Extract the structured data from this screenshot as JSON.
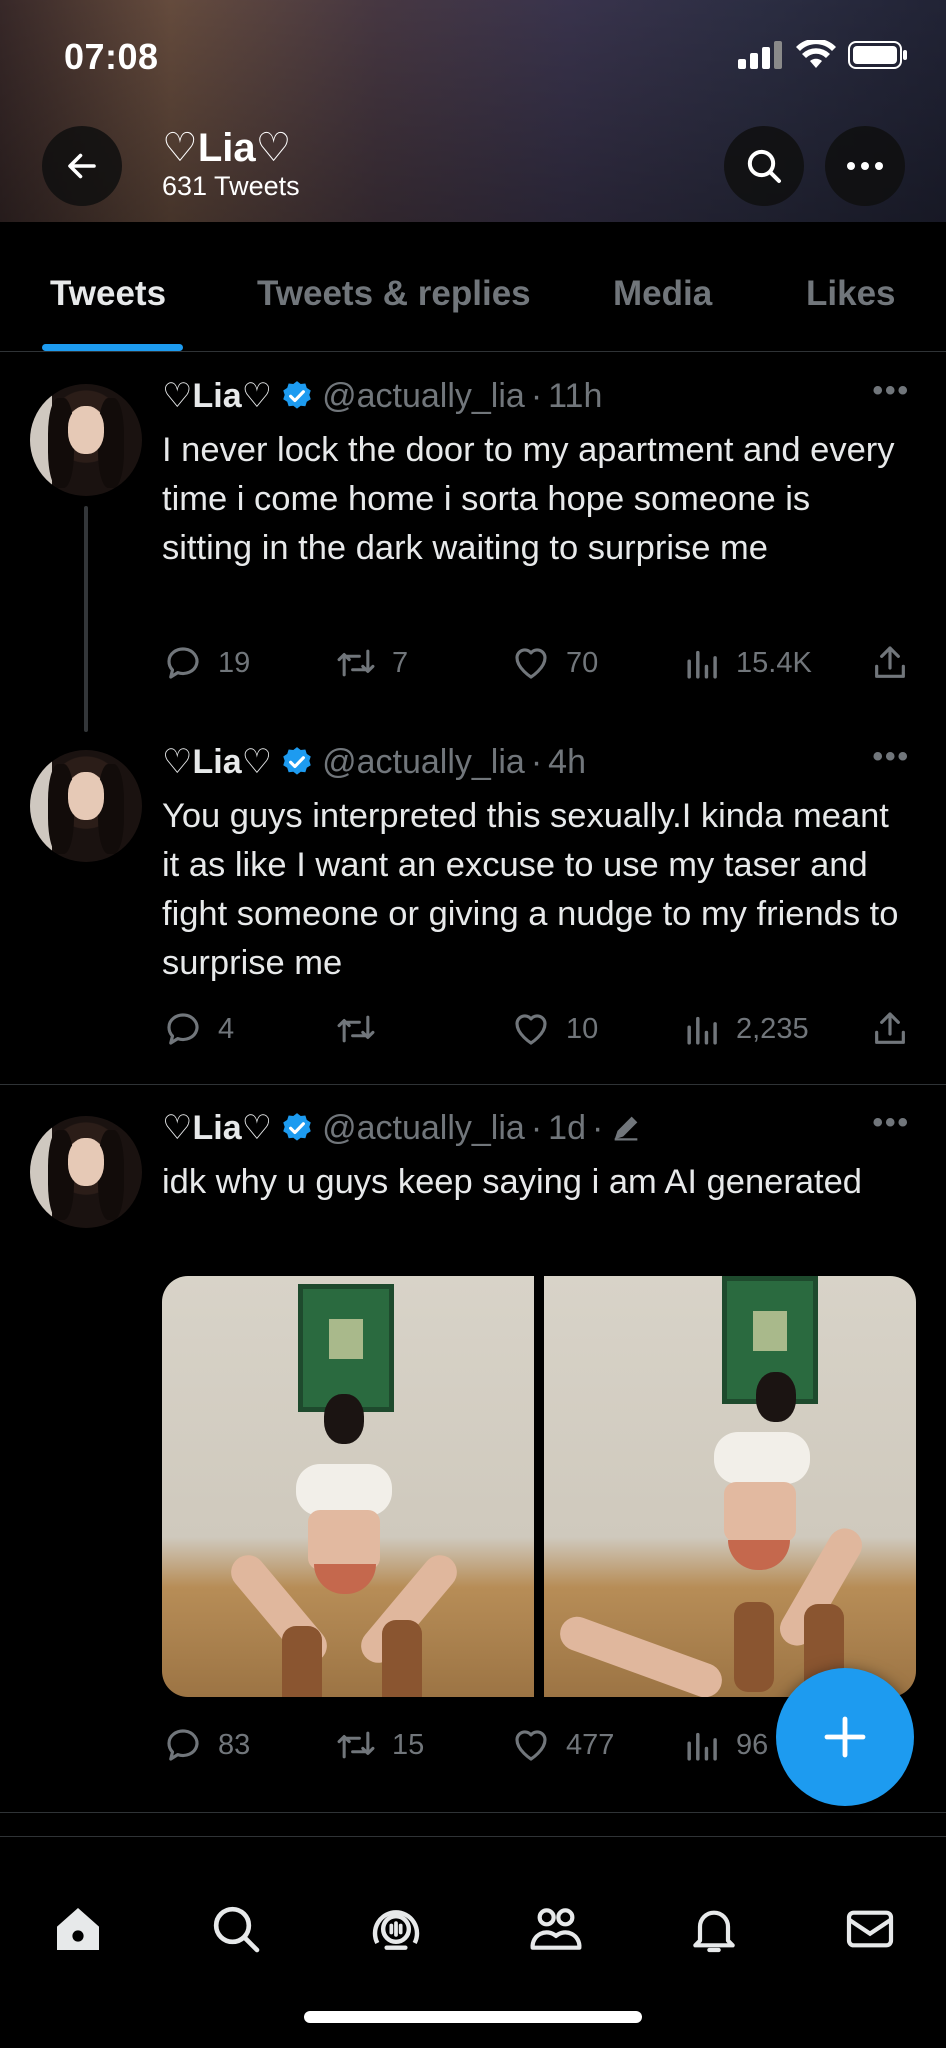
{
  "status_bar": {
    "time": "07:08"
  },
  "header": {
    "name": "♡Lia♡",
    "tweet_count": "631 Tweets"
  },
  "tabs": [
    {
      "label": "Tweets",
      "active": true
    },
    {
      "label": "Tweets & replies",
      "active": false
    },
    {
      "label": "Media",
      "active": false
    },
    {
      "label": "Likes",
      "active": false
    }
  ],
  "tweets": [
    {
      "name": "♡Lia♡",
      "handle": "@actually_lia",
      "time": "11h",
      "text": "I never lock the door to my apartment and every time i come home i sorta hope someone is sitting in the dark waiting to surprise me",
      "replies": "19",
      "retweets": "7",
      "likes": "70",
      "views": "15.4K"
    },
    {
      "name": "♡Lia♡",
      "handle": "@actually_lia",
      "time": "4h",
      "text": "You guys interpreted this sexually.I kinda meant it as like I want an excuse to use my taser and fight someone or giving a nudge to my friends to surprise me",
      "replies": "4",
      "retweets": "",
      "likes": "10",
      "views": "2,235"
    },
    {
      "name": "♡Lia♡",
      "handle": "@actually_lia",
      "time": "1d",
      "text": "idk why u guys keep saying i am AI generated",
      "replies": "83",
      "retweets": "15",
      "likes": "477",
      "views": "96"
    }
  ],
  "icons": {
    "back": "arrow-left-icon",
    "search": "search-icon",
    "more": "more-icon",
    "verified": "verified-badge-icon",
    "reply": "reply-icon",
    "retweet": "retweet-icon",
    "like": "heart-icon",
    "views": "views-icon",
    "share": "share-icon",
    "edit": "edit-pencil-icon",
    "compose": "plus-icon",
    "nav": [
      "home-icon",
      "search-icon",
      "spaces-icon",
      "communities-icon",
      "notifications-icon",
      "messages-icon"
    ]
  },
  "colors": {
    "accent": "#1d9bf0",
    "background": "#000000",
    "text": "#e7e9ea",
    "muted": "#71767b"
  }
}
